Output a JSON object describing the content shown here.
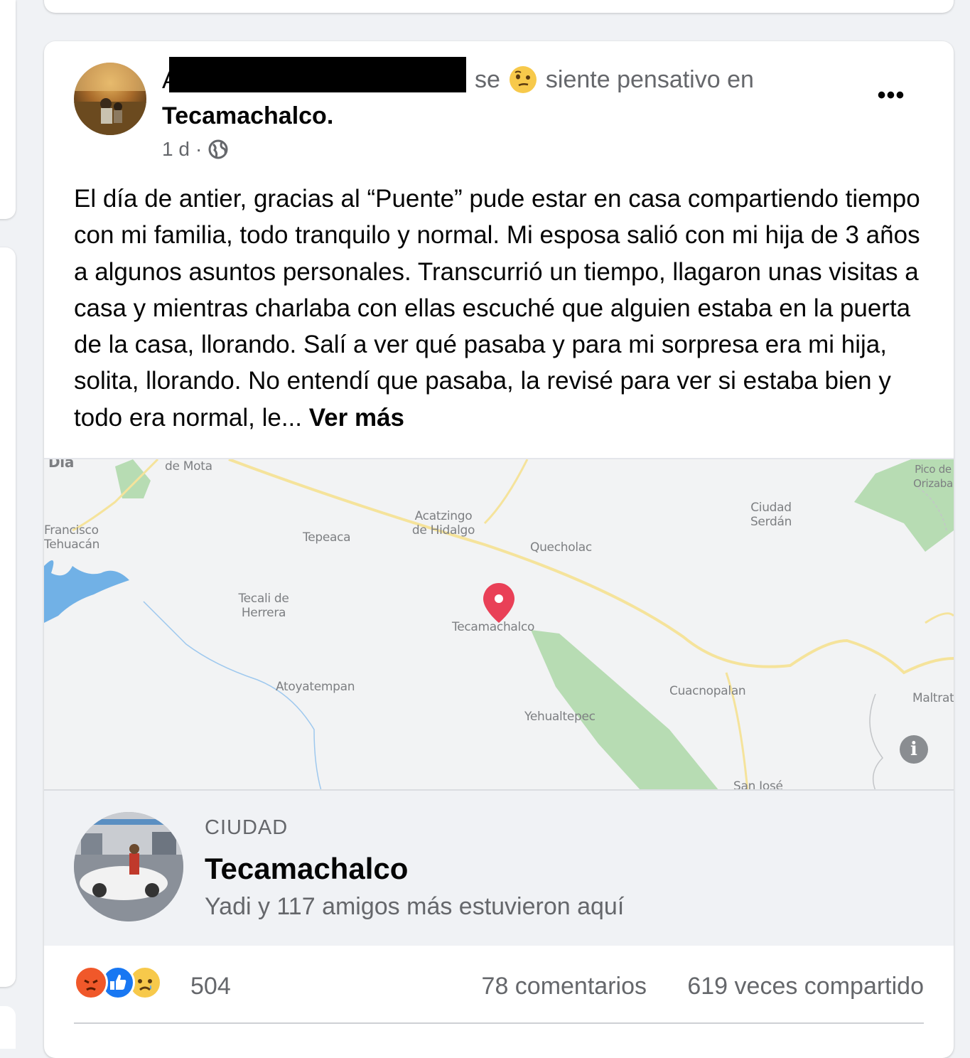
{
  "post": {
    "author_initial": "A",
    "feeling_prefix": "se",
    "feeling_text": "siente pensativo en",
    "feeling_icon": "thinking-face-icon",
    "location_name": "Tecamachalco.",
    "timestamp": "1 d",
    "separator": "·",
    "privacy_icon": "globe-icon",
    "more_icon": "•••",
    "body": "El día de antier, gracias al “Puente” pude estar en casa compartiendo tiempo con mi familia, todo tranquilo y normal. Mi esposa salió con mi hija de 3 años a algunos asuntos personales. Transcurrió un tiempo, llagaron unas visitas a casa y mientras charlaba con ellas escuché que alguien estaba en la puerta de la casa, llorando. Salí a ver qué pasaba y para mi sorpresa era mi hija, solita, llorando. No entendí que pasaba, la revisé para ver si estaba bien y todo era normal, le...",
    "see_more": "Ver más"
  },
  "map": {
    "labels": {
      "mota": "de Mota",
      "dia": "Día",
      "orizaba": "Pico de Orizaba",
      "francisco": "Francisco Tehuacán",
      "tepeaca": "Tepeaca",
      "acatzingo": "Acatzingo de Hidalgo",
      "quecholac": "Quecholac",
      "serdan": "Ciudad Serdán",
      "tecali": "Tecali de Herrera",
      "tecamachalco": "Tecamachalco",
      "atoyatempan": "Atoyatempan",
      "cuacnopalan": "Cuacnopalan",
      "yehualtepec": "Yehualtepec",
      "maltrata": "Maltrata",
      "sanjose": "San José"
    },
    "pin_color": "#e94057",
    "info_label": "i"
  },
  "place": {
    "type": "CIUDAD",
    "name": "Tecamachalco",
    "visited": "Yadi y 117 amigos más estuvieron aquí"
  },
  "stats": {
    "reaction_icons": [
      "angry-reaction-icon",
      "like-reaction-icon",
      "sad-reaction-icon"
    ],
    "reaction_count": "504",
    "comments": "78 comentarios",
    "shares": "619 veces compartido"
  },
  "colors": {
    "background": "#f0f2f5",
    "secondary_text": "#65676b",
    "like_blue": "#1877f2",
    "angry_orange": "#f0582a",
    "sad_yellow": "#f7c94b"
  }
}
